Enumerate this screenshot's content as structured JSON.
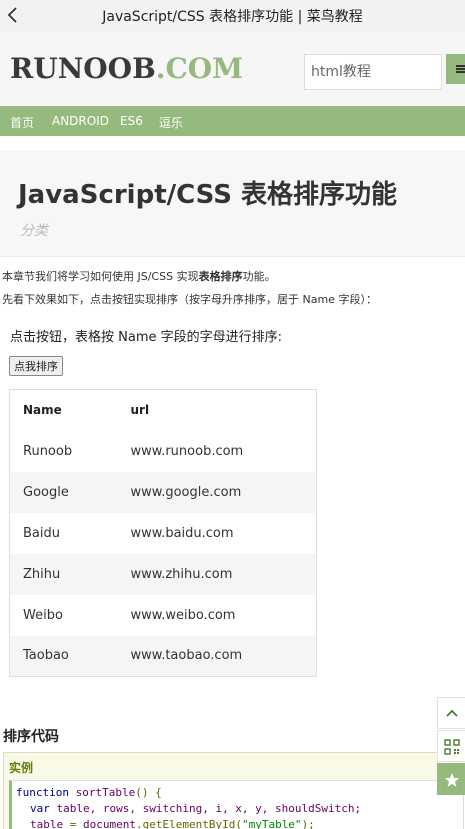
{
  "topbar": {
    "title": "JavaScript/CSS 表格排序功能 | 菜鸟教程",
    "back_icon": "chevron-left-icon"
  },
  "header": {
    "logo_main": "RUNOOB",
    "logo_suffix": ".COM",
    "search_placeholder": "html教程",
    "menu_icon": "hamburger-icon",
    "brand_color": "#96b97d"
  },
  "nav": {
    "items": [
      {
        "label": "首页"
      },
      {
        "label": "ANDROID"
      },
      {
        "label": "ES6"
      },
      {
        "label": "逗乐"
      }
    ]
  },
  "article": {
    "title": "JavaScript/CSS 表格排序功能",
    "category": "分类",
    "intro_1_before": "本章节我们将学习如何使用 JS/CSS 实现",
    "intro_1_bold": "表格排序",
    "intro_1_after": "功能。",
    "intro_2": "先看下效果如下，点击按钮实现排序（按字母升序排序，居于 Name 字段）："
  },
  "demo": {
    "instruction": "点击按钮，表格按 Name 字段的字母进行排序:",
    "button_label": "点我排序",
    "table": {
      "headers": [
        "Name",
        "url"
      ],
      "rows": [
        [
          "Runoob",
          "www.runoob.com"
        ],
        [
          "Google",
          "www.google.com"
        ],
        [
          "Baidu",
          "www.baidu.com"
        ],
        [
          "Zhihu",
          "www.zhihu.com"
        ],
        [
          "Weibo",
          "www.weibo.com"
        ],
        [
          "Taobao",
          "www.taobao.com"
        ]
      ]
    }
  },
  "code_section": {
    "title": "排序代码",
    "example_label": "实例",
    "code": {
      "l1_kw": "function",
      "l1_fn": "sortTable",
      "l1_rest": "() {",
      "l2_kw": "var",
      "l2_rest": "table, rows, switching, i, x, y, shouldSwitch;",
      "l3_a": "table",
      "l3_b": " = ",
      "l3_c": "document",
      "l3_d": ".getElementById(",
      "l3_str": "\"myTable\"",
      "l3_e": ");"
    }
  },
  "float_tools": {
    "top_icon": "chevron-up-icon",
    "qr_icon": "qr-code-icon",
    "fav_icon": "star-icon"
  }
}
